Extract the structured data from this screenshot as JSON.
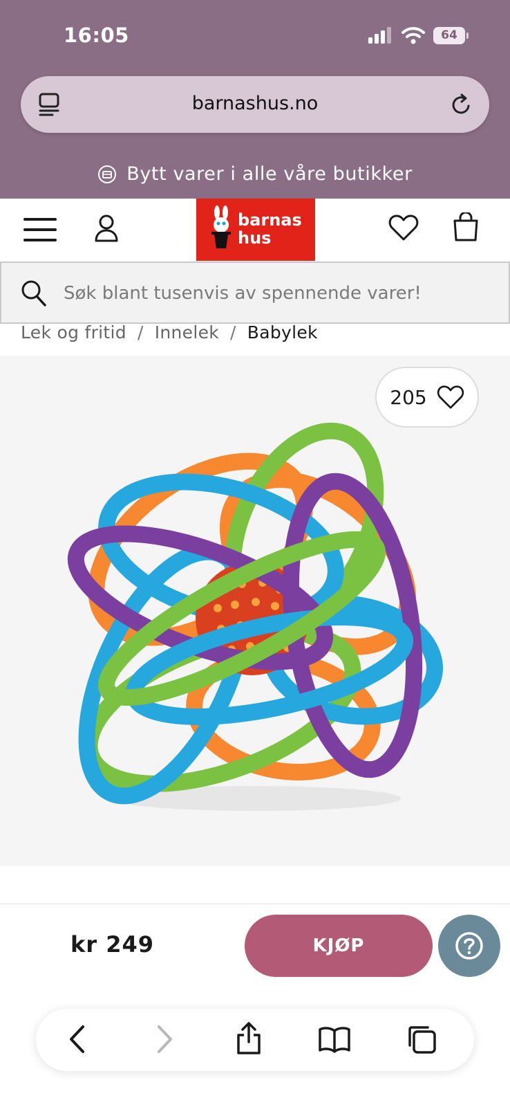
{
  "status": {
    "time": "16:05",
    "battery": "64"
  },
  "browser": {
    "url": "barnashus.no"
  },
  "promo": {
    "text": "Bytt varer i alle våre butikker"
  },
  "logo": {
    "line1": "barnas",
    "line2": "hus"
  },
  "search": {
    "placeholder": "Søk blant tusenvis av spennende varer!"
  },
  "breadcrumb": {
    "items": [
      "Lek og fritid",
      "Innelek",
      "Babylek"
    ],
    "separator": "/"
  },
  "product": {
    "wishlist_count": "205"
  },
  "purchase": {
    "price": "kr 249",
    "buy_label": "KJØP"
  },
  "colors": {
    "browser_chrome": "#8a6e86",
    "logo_red": "#e2231a",
    "buy_button": "#b35a77",
    "help_button": "#6a8a9a"
  }
}
